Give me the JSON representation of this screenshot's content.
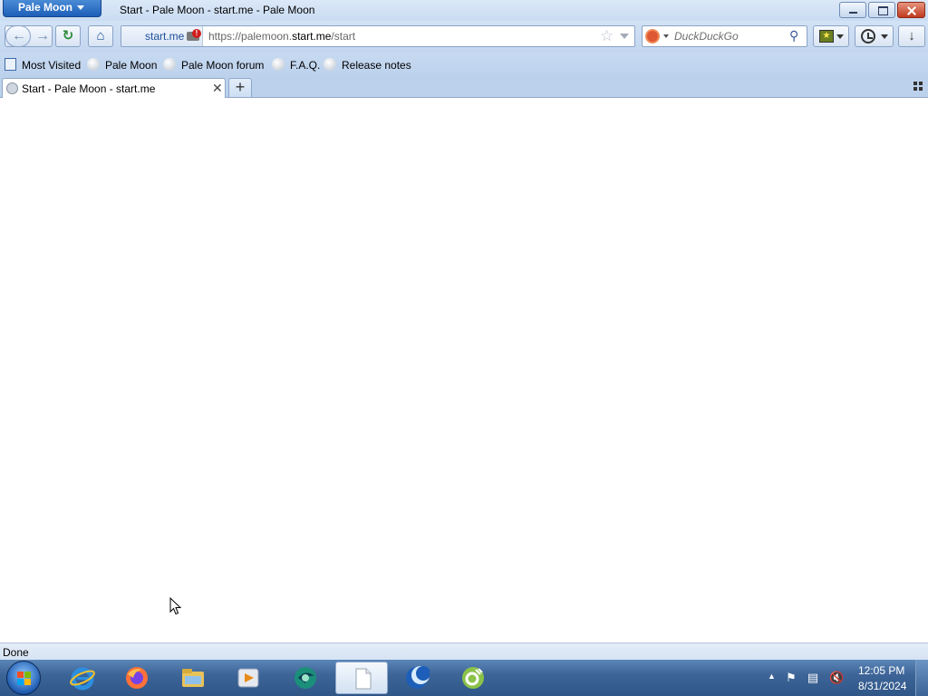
{
  "window": {
    "app_menu_label": "Pale Moon",
    "title": "Start - Pale Moon - start.me - Pale Moon"
  },
  "navbar": {
    "identity_label": "start.me",
    "url_prefix": "https://palemoon.",
    "url_domain": "start.me",
    "url_path": "/start",
    "search_placeholder": "DuckDuckGo"
  },
  "bookmarks": [
    {
      "label": "Most Visited",
      "icon": "most-visited-icon"
    },
    {
      "label": "Pale Moon",
      "icon": "globe-icon"
    },
    {
      "label": "Pale Moon forum",
      "icon": "globe-icon"
    },
    {
      "label": "F.A.Q.",
      "icon": "globe-icon"
    },
    {
      "label": "Release notes",
      "icon": "globe-icon"
    }
  ],
  "tabs": [
    {
      "label": "Start - Pale Moon - start.me",
      "active": true
    }
  ],
  "status": {
    "text": "Done"
  },
  "taskbar": {
    "apps": [
      {
        "name": "internet-explorer-icon",
        "active": false
      },
      {
        "name": "firefox-icon",
        "active": false
      },
      {
        "name": "file-explorer-icon",
        "active": false
      },
      {
        "name": "media-player-icon",
        "active": false
      },
      {
        "name": "app-teal-icon",
        "active": false
      },
      {
        "name": "blank-document-icon",
        "active": true
      },
      {
        "name": "pale-moon-icon",
        "active": false
      },
      {
        "name": "app-green-icon",
        "active": false
      }
    ],
    "clock_time": "12:05 PM",
    "clock_date": "8/31/2024"
  },
  "colors": {
    "accent": "#1d5fb8",
    "close_red": "#c0391f",
    "taskbar": "#3e6598"
  }
}
